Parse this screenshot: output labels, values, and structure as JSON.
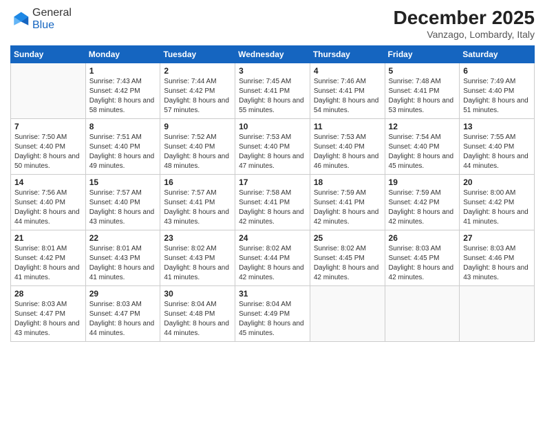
{
  "header": {
    "logo_general": "General",
    "logo_blue": "Blue",
    "month_year": "December 2025",
    "location": "Vanzago, Lombardy, Italy"
  },
  "weekdays": [
    "Sunday",
    "Monday",
    "Tuesday",
    "Wednesday",
    "Thursday",
    "Friday",
    "Saturday"
  ],
  "weeks": [
    [
      {
        "day": "",
        "empty": true
      },
      {
        "day": "1",
        "sunrise": "7:43 AM",
        "sunset": "4:42 PM",
        "daylight": "8 hours and 58 minutes."
      },
      {
        "day": "2",
        "sunrise": "7:44 AM",
        "sunset": "4:42 PM",
        "daylight": "8 hours and 57 minutes."
      },
      {
        "day": "3",
        "sunrise": "7:45 AM",
        "sunset": "4:41 PM",
        "daylight": "8 hours and 55 minutes."
      },
      {
        "day": "4",
        "sunrise": "7:46 AM",
        "sunset": "4:41 PM",
        "daylight": "8 hours and 54 minutes."
      },
      {
        "day": "5",
        "sunrise": "7:48 AM",
        "sunset": "4:41 PM",
        "daylight": "8 hours and 53 minutes."
      },
      {
        "day": "6",
        "sunrise": "7:49 AM",
        "sunset": "4:40 PM",
        "daylight": "8 hours and 51 minutes."
      }
    ],
    [
      {
        "day": "7",
        "sunrise": "7:50 AM",
        "sunset": "4:40 PM",
        "daylight": "8 hours and 50 minutes."
      },
      {
        "day": "8",
        "sunrise": "7:51 AM",
        "sunset": "4:40 PM",
        "daylight": "8 hours and 49 minutes."
      },
      {
        "day": "9",
        "sunrise": "7:52 AM",
        "sunset": "4:40 PM",
        "daylight": "8 hours and 48 minutes."
      },
      {
        "day": "10",
        "sunrise": "7:53 AM",
        "sunset": "4:40 PM",
        "daylight": "8 hours and 47 minutes."
      },
      {
        "day": "11",
        "sunrise": "7:53 AM",
        "sunset": "4:40 PM",
        "daylight": "8 hours and 46 minutes."
      },
      {
        "day": "12",
        "sunrise": "7:54 AM",
        "sunset": "4:40 PM",
        "daylight": "8 hours and 45 minutes."
      },
      {
        "day": "13",
        "sunrise": "7:55 AM",
        "sunset": "4:40 PM",
        "daylight": "8 hours and 44 minutes."
      }
    ],
    [
      {
        "day": "14",
        "sunrise": "7:56 AM",
        "sunset": "4:40 PM",
        "daylight": "8 hours and 44 minutes."
      },
      {
        "day": "15",
        "sunrise": "7:57 AM",
        "sunset": "4:40 PM",
        "daylight": "8 hours and 43 minutes."
      },
      {
        "day": "16",
        "sunrise": "7:57 AM",
        "sunset": "4:41 PM",
        "daylight": "8 hours and 43 minutes."
      },
      {
        "day": "17",
        "sunrise": "7:58 AM",
        "sunset": "4:41 PM",
        "daylight": "8 hours and 42 minutes."
      },
      {
        "day": "18",
        "sunrise": "7:59 AM",
        "sunset": "4:41 PM",
        "daylight": "8 hours and 42 minutes."
      },
      {
        "day": "19",
        "sunrise": "7:59 AM",
        "sunset": "4:42 PM",
        "daylight": "8 hours and 42 minutes."
      },
      {
        "day": "20",
        "sunrise": "8:00 AM",
        "sunset": "4:42 PM",
        "daylight": "8 hours and 41 minutes."
      }
    ],
    [
      {
        "day": "21",
        "sunrise": "8:01 AM",
        "sunset": "4:42 PM",
        "daylight": "8 hours and 41 minutes."
      },
      {
        "day": "22",
        "sunrise": "8:01 AM",
        "sunset": "4:43 PM",
        "daylight": "8 hours and 41 minutes."
      },
      {
        "day": "23",
        "sunrise": "8:02 AM",
        "sunset": "4:43 PM",
        "daylight": "8 hours and 41 minutes."
      },
      {
        "day": "24",
        "sunrise": "8:02 AM",
        "sunset": "4:44 PM",
        "daylight": "8 hours and 42 minutes."
      },
      {
        "day": "25",
        "sunrise": "8:02 AM",
        "sunset": "4:45 PM",
        "daylight": "8 hours and 42 minutes."
      },
      {
        "day": "26",
        "sunrise": "8:03 AM",
        "sunset": "4:45 PM",
        "daylight": "8 hours and 42 minutes."
      },
      {
        "day": "27",
        "sunrise": "8:03 AM",
        "sunset": "4:46 PM",
        "daylight": "8 hours and 43 minutes."
      }
    ],
    [
      {
        "day": "28",
        "sunrise": "8:03 AM",
        "sunset": "4:47 PM",
        "daylight": "8 hours and 43 minutes."
      },
      {
        "day": "29",
        "sunrise": "8:03 AM",
        "sunset": "4:47 PM",
        "daylight": "8 hours and 44 minutes."
      },
      {
        "day": "30",
        "sunrise": "8:04 AM",
        "sunset": "4:48 PM",
        "daylight": "8 hours and 44 minutes."
      },
      {
        "day": "31",
        "sunrise": "8:04 AM",
        "sunset": "4:49 PM",
        "daylight": "8 hours and 45 minutes."
      },
      {
        "day": "",
        "empty": true
      },
      {
        "day": "",
        "empty": true
      },
      {
        "day": "",
        "empty": true
      }
    ]
  ]
}
